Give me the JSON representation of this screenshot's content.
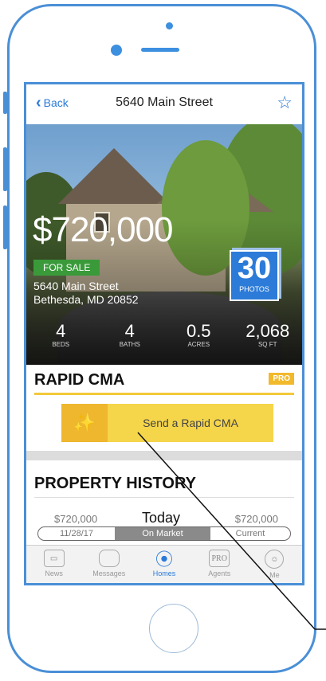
{
  "nav": {
    "back_label": "Back",
    "title": "5640 Main Street"
  },
  "listing": {
    "price": "$720,000",
    "status_badge": "FOR SALE",
    "address_line1": "5640 Main Street",
    "address_line2": "Bethesda, MD 20852",
    "photos_count": "30",
    "photos_label": "PHOTOS",
    "stats": [
      {
        "value": "4",
        "label": "BEDS"
      },
      {
        "value": "4",
        "label": "BATHS"
      },
      {
        "value": "0.5",
        "label": "ACRES"
      },
      {
        "value": "2,068",
        "label": "SQ FT"
      }
    ]
  },
  "rapid_cma": {
    "title": "RAPID CMA",
    "pro_badge": "PRO",
    "button_label": "Send a Rapid CMA"
  },
  "property_history": {
    "title": "PROPERTY HISTORY",
    "left_price": "$720,000",
    "center_label": "Today",
    "right_price": "$720,000",
    "left_date": "11/28/17",
    "center_status": "On Market",
    "right_status": "Current"
  },
  "tabs": [
    {
      "label": "News",
      "icon": "news-icon"
    },
    {
      "label": "Messages",
      "icon": "messages-icon"
    },
    {
      "label": "Homes",
      "icon": "homes-pin-icon",
      "active": true
    },
    {
      "label": "Agents",
      "icon": "agents-pro-icon",
      "icon_text": "PRO"
    },
    {
      "label": "Me",
      "icon": "me-avatar-icon"
    }
  ],
  "colors": {
    "accent_blue": "#2a7ad8",
    "cma_yellow": "#f5d54a",
    "pro_orange": "#f2b92c",
    "sale_green": "#3a9a3a"
  }
}
